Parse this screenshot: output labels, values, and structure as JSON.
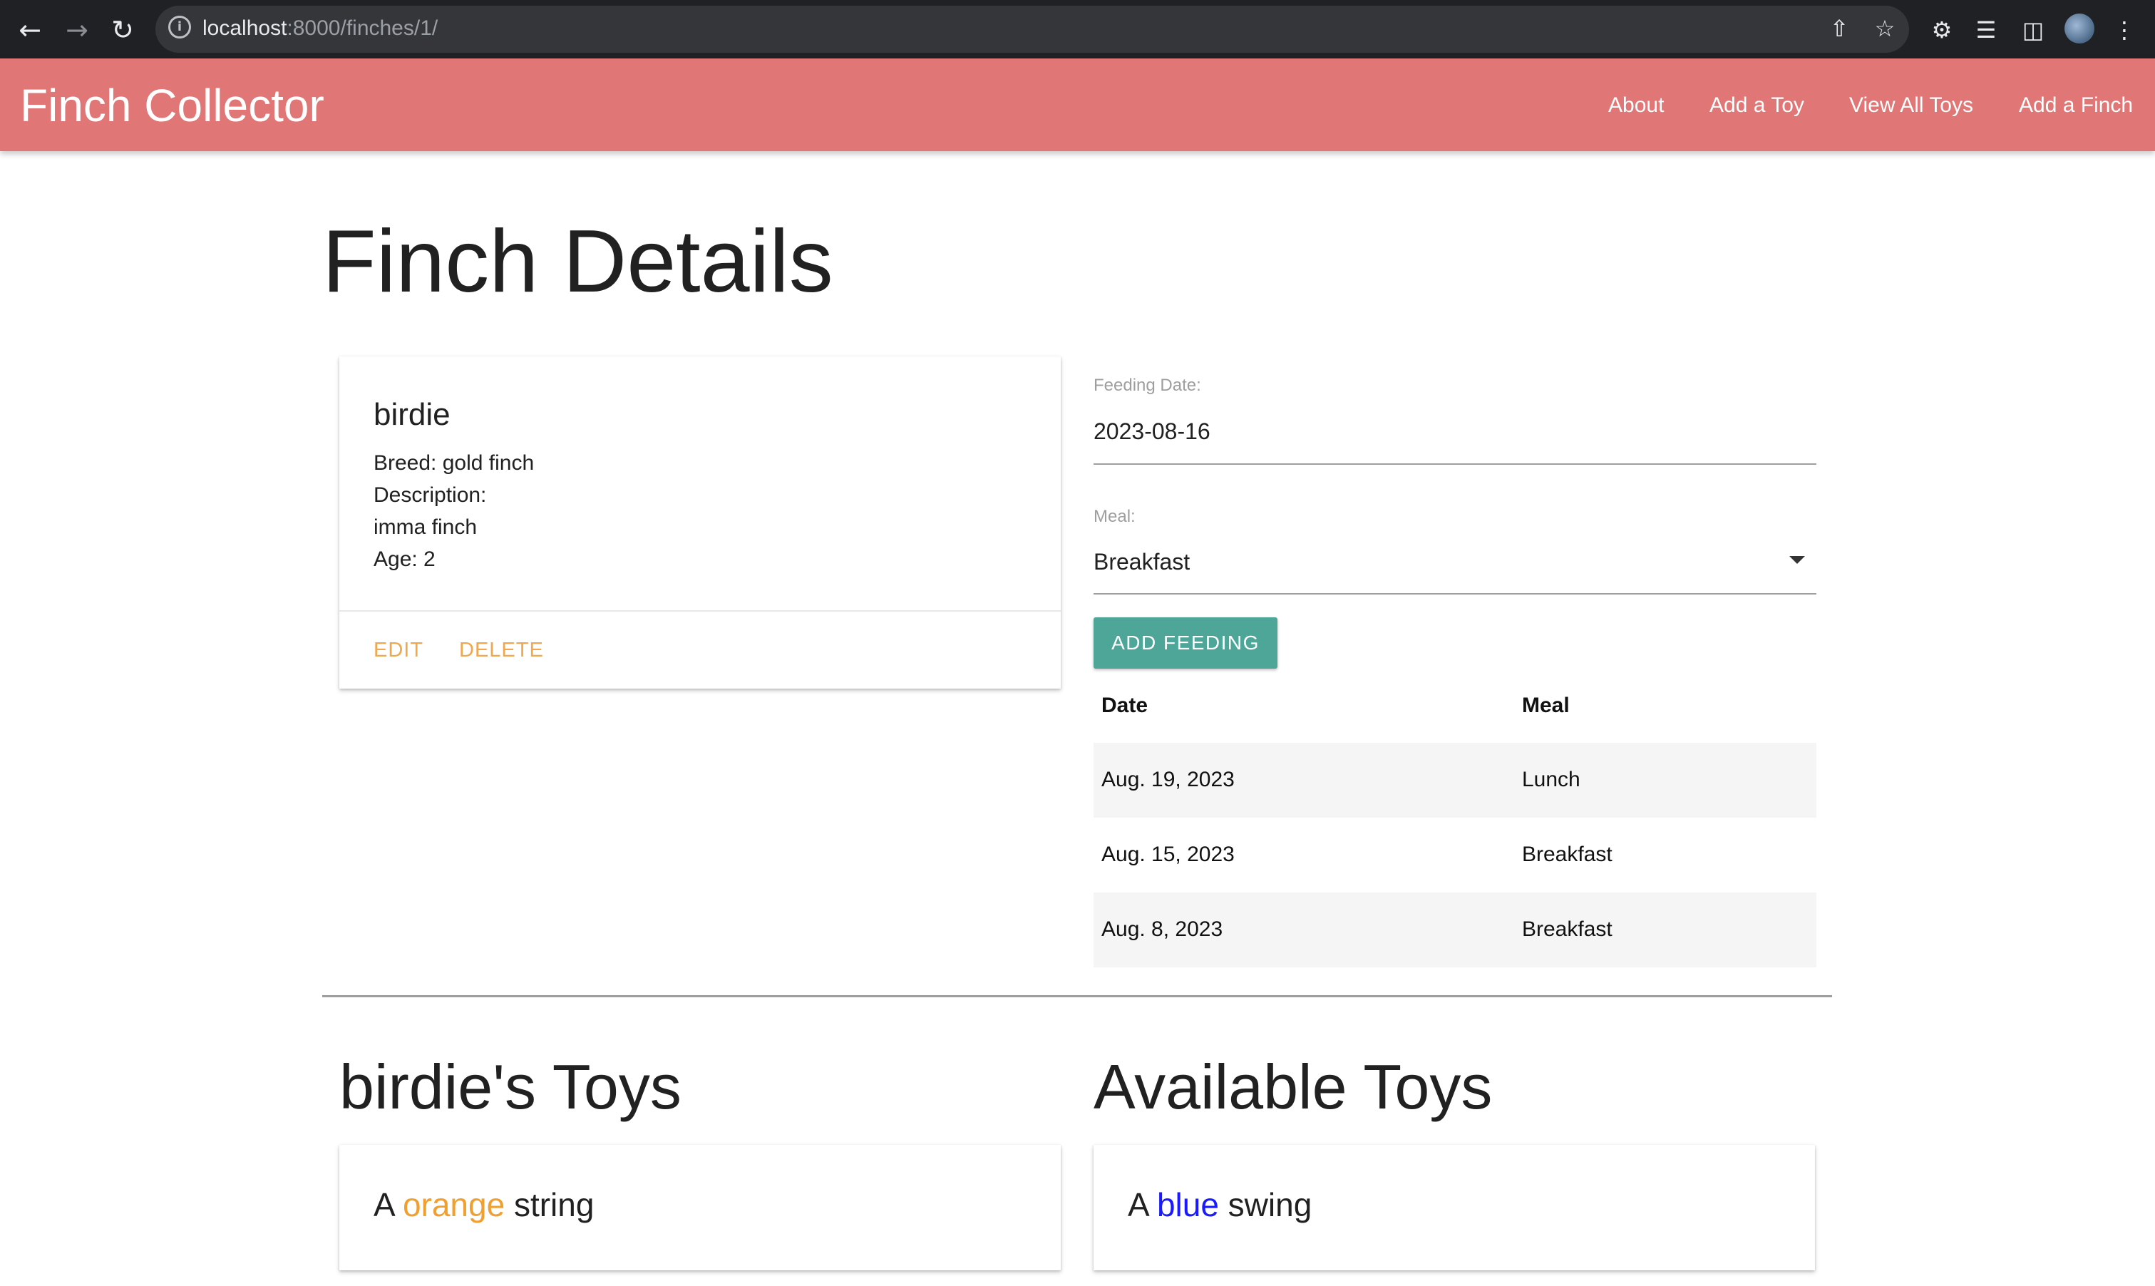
{
  "browser": {
    "url_host": "localhost",
    "url_path": ":8000/finches/1/"
  },
  "navbar": {
    "brand": "Finch Collector",
    "links": [
      "About",
      "Add a Toy",
      "View All Toys",
      "Add a Finch"
    ]
  },
  "page": {
    "title": "Finch Details"
  },
  "finch": {
    "name": "birdie",
    "breed_line": "Breed: gold finch",
    "description_label": "Description:",
    "description": "imma finch",
    "age_line": "Age: 2",
    "actions": [
      "EDIT",
      "DELETE"
    ]
  },
  "feeding_form": {
    "date_label": "Feeding Date:",
    "date_value": "2023-08-16",
    "meal_label": "Meal:",
    "meal_value": "Breakfast",
    "submit_label": "ADD FEEDING"
  },
  "feedings_table": {
    "headers": [
      "Date",
      "Meal"
    ],
    "rows": [
      [
        "Aug. 19, 2023",
        "Lunch"
      ],
      [
        "Aug. 15, 2023",
        "Breakfast"
      ],
      [
        "Aug. 8, 2023",
        "Breakfast"
      ]
    ]
  },
  "toys": {
    "finch_toys_title": "birdie's Toys",
    "available_title": "Available Toys",
    "finch_toy": {
      "prefix": "A ",
      "color": "orange",
      "name": " string",
      "color_hex": "#f0a030"
    },
    "available_toy": {
      "prefix": "A ",
      "color": "blue",
      "name": " swing",
      "color_hex": "#1a1aff"
    }
  },
  "colors": {
    "navbar": "#e07676",
    "action_text": "#f0a74e",
    "button": "#4ea699"
  }
}
